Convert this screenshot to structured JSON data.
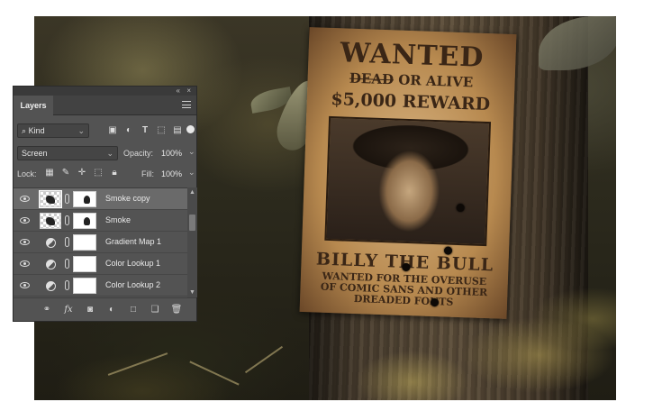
{
  "photo": {
    "poster": {
      "title": "WANTED",
      "sub_struck": "DEAD",
      "sub_rest": "OR ALIVE",
      "reward": "$5,000 REWARD",
      "name": "BILLY THE BULL",
      "desc_line1": "WANTED FOR THE OVERUSE",
      "desc_line2": "OF COMIC SANS AND OTHER",
      "desc_line3": "DREADED FONTS"
    }
  },
  "panel": {
    "tab": "Layers",
    "filter": {
      "kind": "Kind",
      "icons": [
        "image-filter-icon",
        "adjustment-filter-icon",
        "type-filter-icon",
        "shape-filter-icon",
        "smart-object-filter-icon"
      ],
      "toggle_icon": "filter-toggle-icon"
    },
    "blend_mode": "Screen",
    "opacity_label": "Opacity:",
    "opacity_value": "100%",
    "lock_label": "Lock:",
    "fill_label": "Fill:",
    "fill_value": "100%",
    "layers": [
      {
        "name": "Smoke copy",
        "type": "pixel",
        "selected": true
      },
      {
        "name": "Smoke",
        "type": "pixel",
        "selected": false
      },
      {
        "name": "Gradient Map 1",
        "type": "adjustment",
        "selected": false
      },
      {
        "name": "Color Lookup 1",
        "type": "adjustment",
        "selected": false
      },
      {
        "name": "Color Lookup 2",
        "type": "adjustment",
        "selected": false
      }
    ],
    "footer_icons": [
      "link-layers-icon",
      "fx-icon",
      "add-mask-icon",
      "new-adjustment-icon",
      "new-group-icon",
      "new-layer-icon",
      "delete-layer-icon"
    ],
    "colors": {
      "panel_bg": "#535353",
      "selected_row": "#6a6a6a",
      "text": "#e6e6e6"
    }
  }
}
